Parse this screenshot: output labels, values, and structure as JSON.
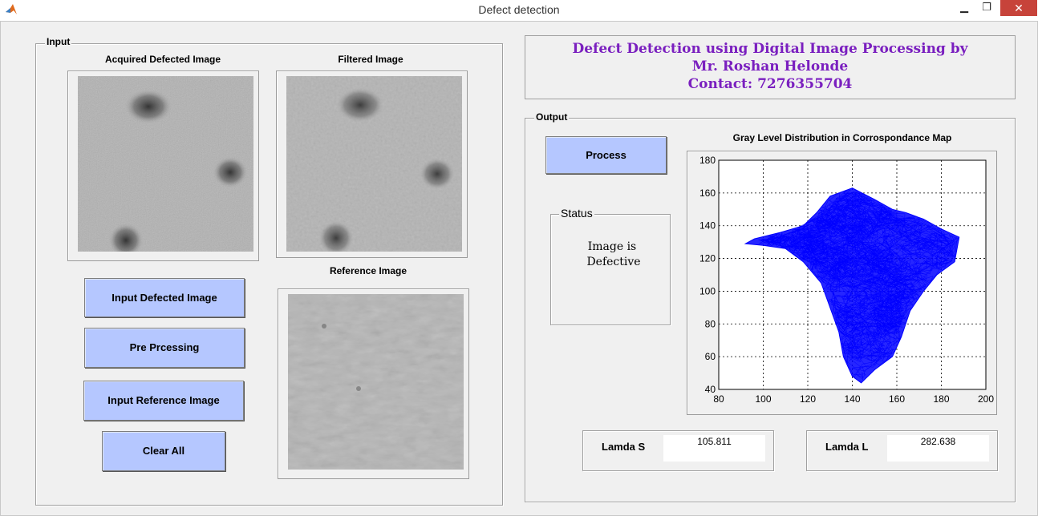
{
  "window": {
    "title": "Defect detection",
    "minimize_label": "▁",
    "maximize_label": "❐",
    "close_label": "✕",
    "icon": "matlab-icon"
  },
  "header": {
    "line1": "Defect Detection using Digital Image Processing by",
    "line2": "Mr. Roshan Helonde",
    "line3": "Contact: 7276355704",
    "color": "#7a1fbf"
  },
  "input_panel": {
    "label": "Input",
    "acquired_title": "Acquired Defected Image",
    "filtered_title": "Filtered Image",
    "reference_title": "Reference Image",
    "buttons": {
      "input_defected": "Input Defected Image",
      "pre_processing": "Pre Prcessing",
      "input_reference": "Input Reference Image",
      "clear_all": "Clear All"
    }
  },
  "output_panel": {
    "label": "Output",
    "process_button": "Process",
    "status_label": "Status",
    "status_line1": "Image is",
    "status_line2": "Defective",
    "lamda_s_label": "Lamda S",
    "lamda_s_value": "105.811",
    "lamda_l_label": "Lamda L",
    "lamda_l_value": "282.638"
  },
  "colors": {
    "button_bg": "#b5c7ff",
    "plot_line": "#0000ff",
    "close_button": "#c7433a"
  },
  "chart_data": {
    "type": "line",
    "title": "Gray Level Distribution in Corrospondance Map",
    "xlabel": "",
    "ylabel": "",
    "xlim": [
      80,
      200
    ],
    "ylim": [
      40,
      180
    ],
    "xticks": [
      "80",
      "100",
      "120",
      "140",
      "160",
      "180",
      "200"
    ],
    "yticks": [
      "40",
      "60",
      "80",
      "100",
      "120",
      "140",
      "160",
      "180"
    ],
    "grid": true,
    "series": [
      {
        "color": "#0000ff",
        "outline": [
          [
            130,
            158
          ],
          [
            140,
            163
          ],
          [
            150,
            156
          ],
          [
            158,
            150
          ],
          [
            164,
            148
          ],
          [
            172,
            144
          ],
          [
            180,
            138
          ],
          [
            188,
            133
          ],
          [
            186,
            118
          ],
          [
            178,
            110
          ],
          [
            172,
            100
          ],
          [
            166,
            88
          ],
          [
            162,
            72
          ],
          [
            158,
            60
          ],
          [
            150,
            52
          ],
          [
            144,
            44
          ],
          [
            140,
            48
          ],
          [
            136,
            60
          ],
          [
            134,
            75
          ],
          [
            130,
            90
          ],
          [
            126,
            105
          ],
          [
            118,
            118
          ],
          [
            110,
            126
          ],
          [
            100,
            128
          ],
          [
            92,
            129
          ],
          [
            96,
            132
          ],
          [
            108,
            136
          ],
          [
            118,
            140
          ],
          [
            124,
            148
          ]
        ]
      }
    ]
  }
}
